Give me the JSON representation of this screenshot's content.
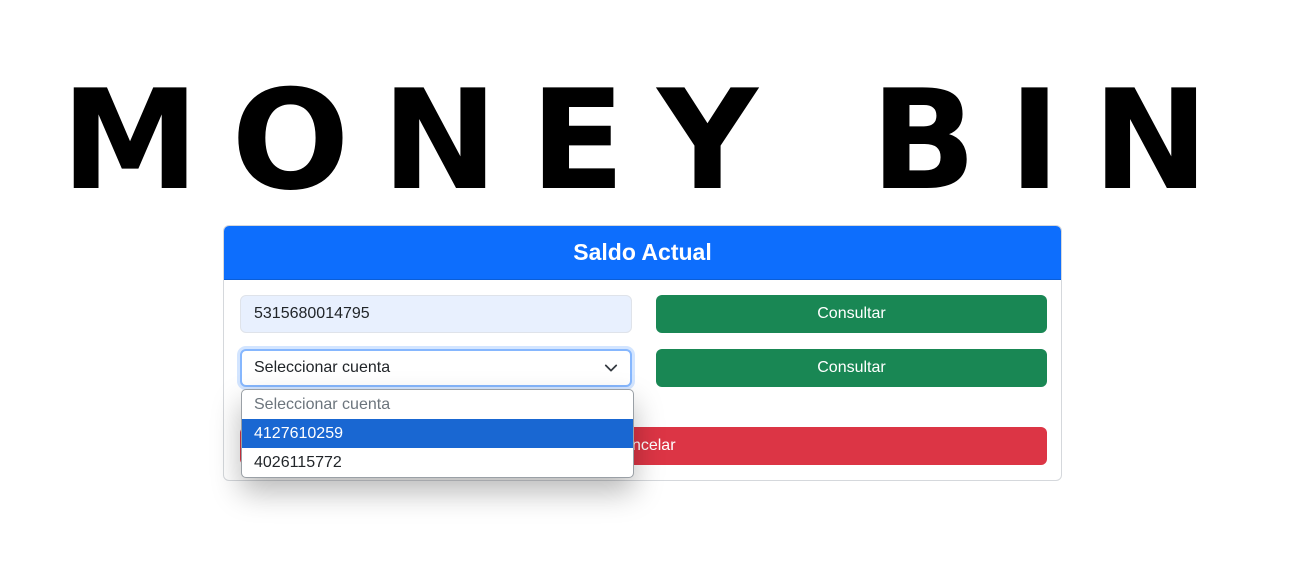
{
  "logo": {
    "text": "MONEY BIN"
  },
  "card": {
    "title": "Saldo Actual",
    "card_number": "5315680014795",
    "select": {
      "value": "Seleccionar cuenta",
      "options": [
        "Seleccionar cuenta",
        "4127610259",
        "4026115772"
      ],
      "highlighted": "4127610259"
    },
    "consult_button_1": "Consultar",
    "consult_button_2": "Consultar",
    "cancel_button": "Cancelar"
  },
  "colors": {
    "header": "#0d6efd",
    "success": "#198754",
    "danger": "#dc3545",
    "option_highlight": "#1967d2"
  }
}
